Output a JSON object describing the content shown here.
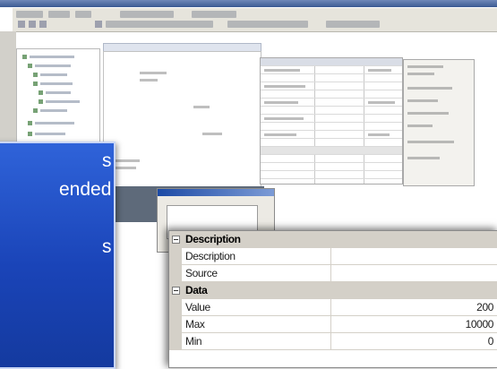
{
  "overlay": {
    "lines": [
      "s",
      "ended",
      "",
      "s"
    ]
  },
  "properties": {
    "sections": [
      {
        "title": "Description",
        "rows": [
          {
            "name": "Description",
            "value": ""
          },
          {
            "name": "Source",
            "value": ""
          }
        ]
      },
      {
        "title": "Data",
        "rows": [
          {
            "name": "Value",
            "value": "200"
          },
          {
            "name": "Max",
            "value": "10000"
          },
          {
            "name": "Min",
            "value": "0"
          }
        ]
      }
    ]
  },
  "colors": {
    "overlay": "#1a44b8",
    "value_text": "#1c1c1c",
    "section_bg": "#d4d0c8"
  }
}
